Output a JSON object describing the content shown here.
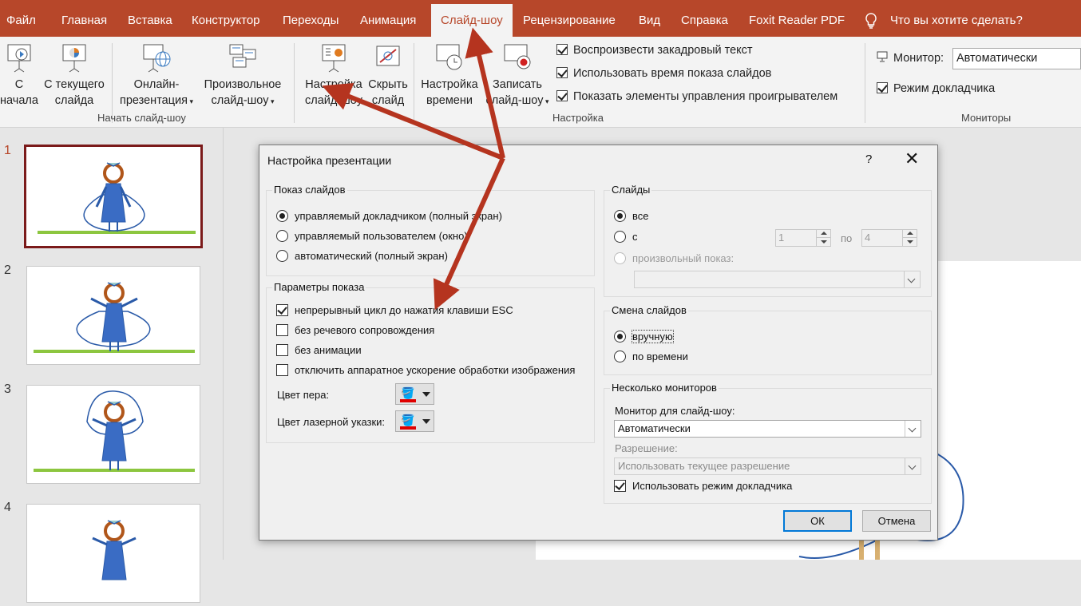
{
  "menu": {
    "tabs": [
      "Файл",
      "Главная",
      "Вставка",
      "Конструктор",
      "Переходы",
      "Анимация",
      "Слайд-шоу",
      "Рецензирование",
      "Вид",
      "Справка",
      "Foxit Reader PDF"
    ],
    "active_index": 6,
    "tell_me": "Что вы хотите сделать?"
  },
  "ribbon": {
    "start": {
      "from_beginning": [
        "С",
        "начала"
      ],
      "from_current": [
        "С текущего",
        "слайда"
      ],
      "online": [
        "Онлайн-",
        "презентация"
      ],
      "custom": [
        "Произвольное",
        "слайд-шоу"
      ],
      "group_label": "Начать слайд-шоу"
    },
    "setup": {
      "setup_show": [
        "Настройка",
        "слайд-шоу"
      ],
      "hide_slide": [
        "Скрыть",
        "слайд"
      ],
      "rehearse": [
        "Настройка",
        "времени"
      ],
      "record": [
        "Записать",
        "слайд-шоу"
      ],
      "play_narrations": "Воспроизвести закадровый текст",
      "use_timings": "Использовать время показа слайдов",
      "show_media_controls": "Показать элементы управления проигрывателем",
      "group_label": "Настройка"
    },
    "monitors": {
      "monitor_label": "Монитор:",
      "monitor_value": "Автоматически",
      "presenter_view": "Режим докладчика",
      "group_label": "Мониторы"
    }
  },
  "thumbnails": [
    "1",
    "2",
    "3",
    "4"
  ],
  "dialog": {
    "title": "Настройка презентации",
    "help": "?",
    "close": "✕",
    "show_type": {
      "label": "Показ слайдов",
      "options": [
        "управляемый докладчиком (полный экран)",
        "управляемый пользователем (окно)",
        "автоматический (полный экран)"
      ],
      "selected": 0
    },
    "show_options": {
      "label": "Параметры показа",
      "loop": "непрерывный цикл до нажатия клавиши ESC",
      "no_narration": "без речевого сопровождения",
      "no_animation": "без анимации",
      "disable_hw": "отключить аппаратное ускорение обработки изображения",
      "pen_color": "Цвет пера:",
      "laser_color": "Цвет лазерной указки:",
      "pen_color_value": "#e00000",
      "laser_color_value": "#e00000"
    },
    "slides": {
      "label": "Слайды",
      "all": "все",
      "from": "с",
      "from_value": "1",
      "to_label": "по",
      "to_value": "4",
      "custom_show": "произвольный показ:"
    },
    "advance": {
      "label": "Смена слайдов",
      "manual": "вручную",
      "timings": "по времени"
    },
    "monitors": {
      "label": "Несколько мониторов",
      "monitor_label": "Монитор для слайд-шоу:",
      "monitor_value": "Автоматически",
      "resolution_label": "Разрешение:",
      "resolution_value": "Использовать текущее разрешение",
      "presenter_view": "Использовать режим докладчика"
    },
    "ok": "ОК",
    "cancel": "Отмена"
  },
  "colors": {
    "accent": "#b7472a",
    "annotation_arrow": "#b5341f"
  }
}
